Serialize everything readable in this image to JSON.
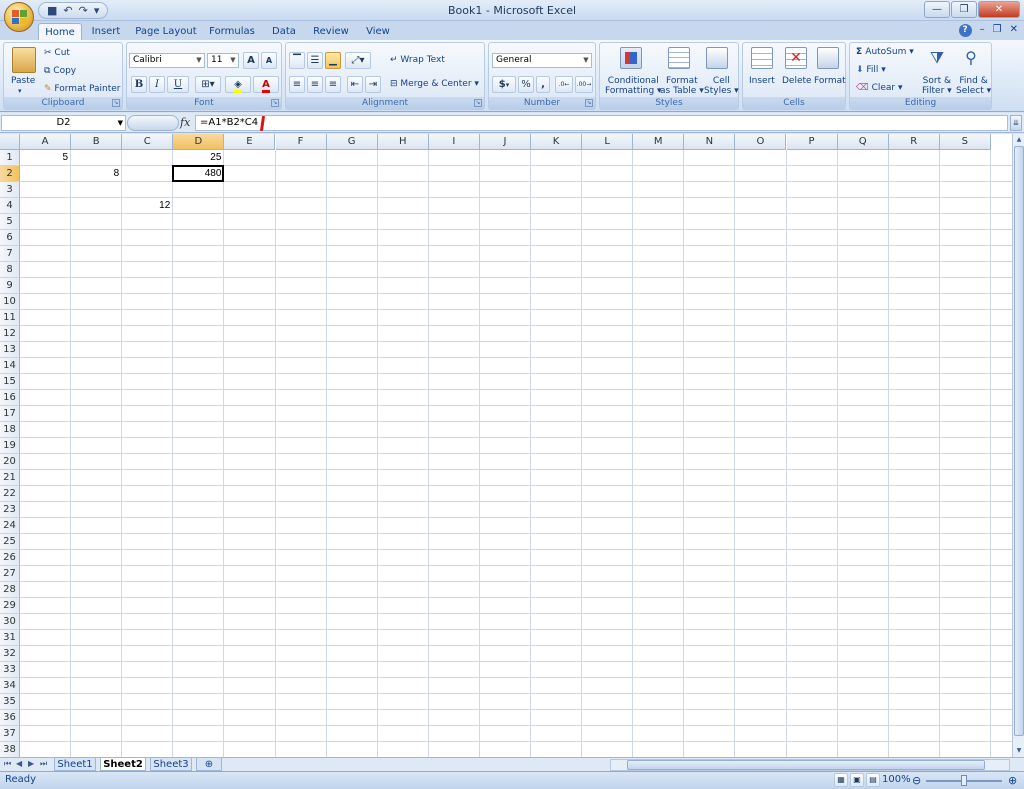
{
  "window": {
    "title": "Book1 - Microsoft Excel"
  },
  "qat": {
    "save": "■",
    "undo": "↶",
    "redo": "↷"
  },
  "tabs": [
    "Home",
    "Insert",
    "Page Layout",
    "Formulas",
    "Data",
    "Review",
    "View"
  ],
  "active_tab": "Home",
  "ribbon": {
    "clipboard": {
      "label": "Clipboard",
      "paste": "Paste",
      "cut": "Cut",
      "copy": "Copy",
      "format_painter": "Format Painter"
    },
    "font": {
      "label": "Font",
      "name": "Calibri",
      "size": "11",
      "grow": "A",
      "shrink": "A",
      "bold": "B",
      "italic": "I",
      "underline": "U"
    },
    "alignment": {
      "label": "Alignment",
      "wrap": "Wrap Text",
      "merge": "Merge & Center"
    },
    "number": {
      "label": "Number",
      "format": "General",
      "currency": "$",
      "percent": "%",
      "comma": ",",
      "inc": ".0→.00",
      "dec": ".00→.0"
    },
    "styles": {
      "label": "Styles",
      "cond_1": "Conditional",
      "cond_2": "Formatting",
      "table_1": "Format",
      "table_2": "as Table",
      "cell_1": "Cell",
      "cell_2": "Styles"
    },
    "cells": {
      "label": "Cells",
      "insert": "Insert",
      "delete": "Delete",
      "format": "Format"
    },
    "editing": {
      "label": "Editing",
      "autosum": "AutoSum",
      "fill": "Fill",
      "clear": "Clear",
      "sort_1": "Sort &",
      "sort_2": "Filter",
      "find_1": "Find &",
      "find_2": "Select"
    }
  },
  "formula_bar": {
    "name_box": "D2",
    "fx": "fx",
    "formula": "=A1*B2*C4"
  },
  "columns": [
    "A",
    "B",
    "C",
    "D",
    "E",
    "F",
    "G",
    "H",
    "I",
    "J",
    "K",
    "L",
    "M",
    "N",
    "O",
    "P",
    "Q",
    "R",
    "S"
  ],
  "rows": [
    "1",
    "2",
    "3",
    "4",
    "5",
    "6",
    "7",
    "8",
    "9",
    "10",
    "11",
    "12",
    "13",
    "14",
    "15",
    "16",
    "17",
    "18",
    "19",
    "20",
    "21",
    "22",
    "23",
    "24",
    "25",
    "26",
    "27",
    "28",
    "29",
    "30",
    "31",
    "32",
    "33",
    "34",
    "35",
    "36",
    "37",
    "38"
  ],
  "cells": [
    {
      "ref": "A1",
      "value": "5"
    },
    {
      "ref": "D1",
      "value": "25"
    },
    {
      "ref": "B2",
      "value": "8"
    },
    {
      "ref": "D2",
      "value": "480"
    },
    {
      "ref": "C4",
      "value": "12"
    }
  ],
  "selected_cell": "D2",
  "sheet_tabs": [
    "Sheet1",
    "Sheet2",
    "Sheet3"
  ],
  "active_sheet": "Sheet2",
  "status": {
    "mode": "Ready",
    "zoom": "100%"
  },
  "colors": {
    "ribbon_blue": "#15428b",
    "selection_orange": "#f1c15f",
    "accent_red": "#d11111"
  }
}
